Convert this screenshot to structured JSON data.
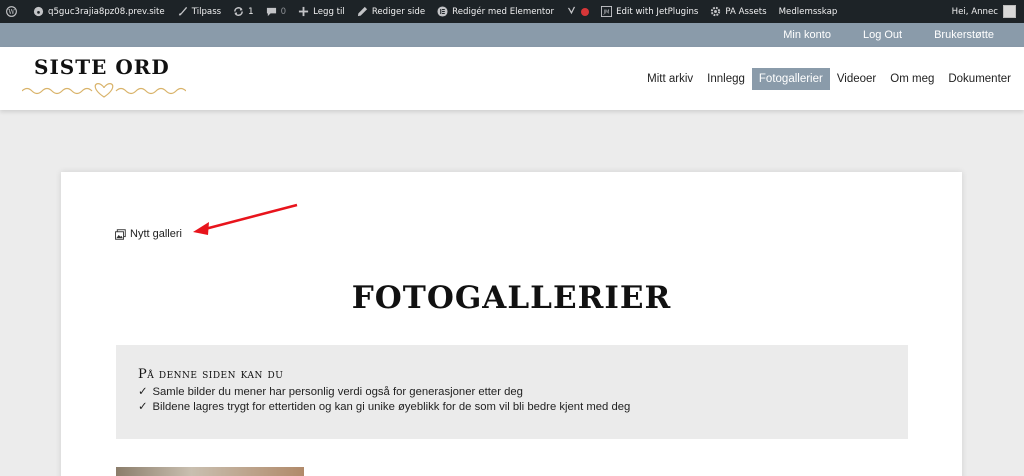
{
  "adminbar": {
    "site": "q5guc3rajia8pz08.prev.site",
    "customize": "Tilpass",
    "updates": "1",
    "comments": "0",
    "add_new": "Legg til",
    "edit_page": "Rediger side",
    "edit_elementor": "Redigér med Elementor",
    "jetplugins": "Edit with JetPlugins",
    "pa_assets": "PA Assets",
    "membership": "Medlemsskap",
    "greeting": "Hei, Annec"
  },
  "topbar": {
    "links": [
      "Min konto",
      "Log Out",
      "Brukerstøtte"
    ]
  },
  "header": {
    "logo": "SISTE ORD",
    "nav": [
      "Mitt arkiv",
      "Innlegg",
      "Fotogallerier",
      "Videoer",
      "Om meg",
      "Dokumenter"
    ],
    "active": "Fotogallerier"
  },
  "main": {
    "new_gallery": "Nytt galleri",
    "title": "FOTOGALLERIER",
    "info_heading": "På denne siden kan du",
    "info_items": [
      "Samle bilder du mener har personlig verdi også for generasjoner etter deg",
      "Bildene lagres trygt for ettertiden og kan gi unike øyeblikk for de som vil bli bedre kjent med deg"
    ],
    "check": "✓"
  },
  "colors": {
    "adminbar": "#1d2327",
    "accent": "#8a9baa",
    "logo_gold": "#d9b36a",
    "arrow": "#e8141c"
  }
}
